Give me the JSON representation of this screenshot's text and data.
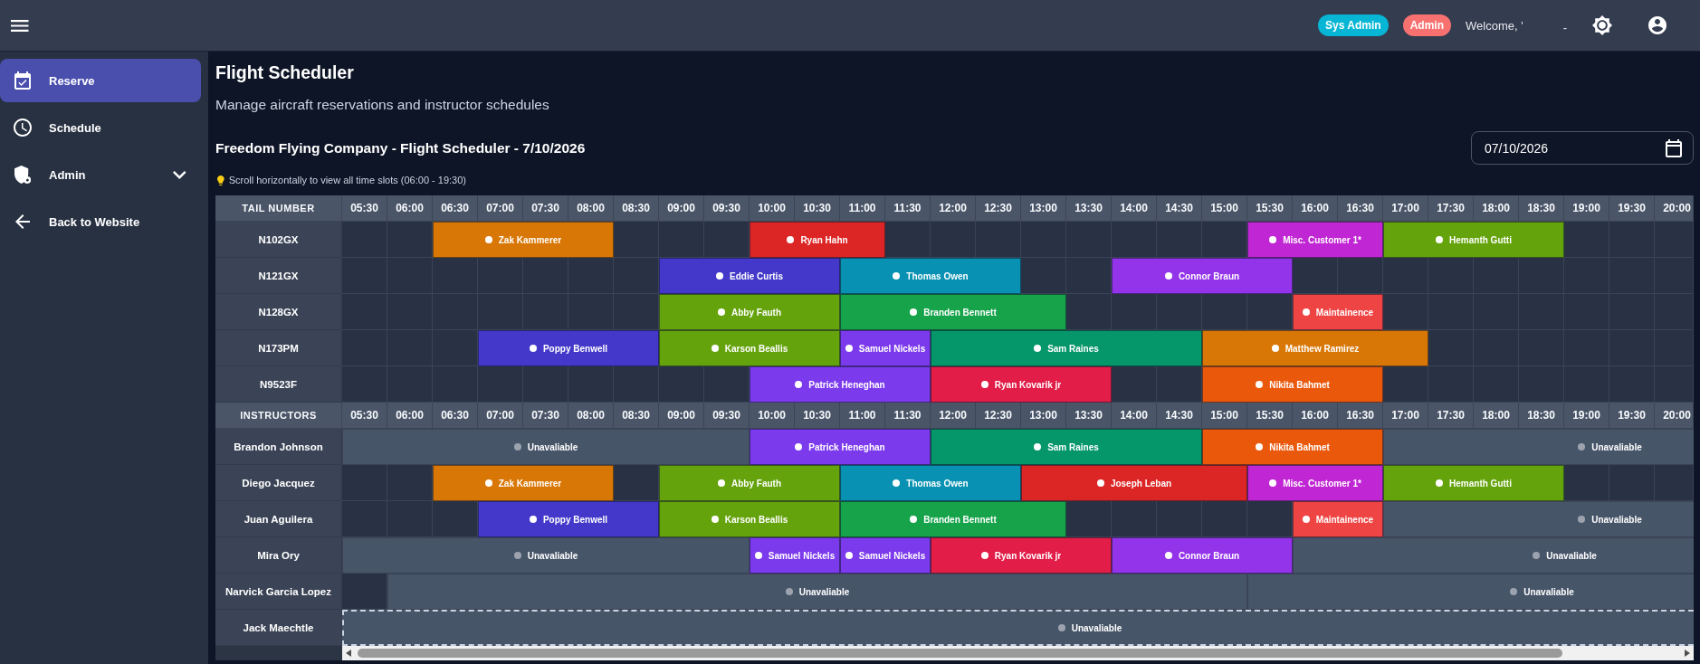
{
  "topbar": {
    "roles": [
      {
        "label": "Sys Admin",
        "color": "#06b6d4"
      },
      {
        "label": "Admin",
        "color": "#f87171"
      }
    ],
    "welcome": "Welcome, '",
    "user": "-"
  },
  "sidebar": {
    "items": [
      {
        "label": "Reserve",
        "kind": "link",
        "selected": true
      },
      {
        "label": "Schedule",
        "kind": "link",
        "selected": false
      },
      {
        "label": "Admin",
        "kind": "group",
        "selected": false,
        "expanded": false
      },
      {
        "label": "Back to Website",
        "kind": "link",
        "selected": false
      }
    ]
  },
  "page": {
    "title": "Flight Scheduler",
    "subtitle": "Manage aircraft reservations and instructor schedules",
    "heading": "Freedom Flying Company - Flight Scheduler - 7/10/2026",
    "date_field": {
      "value": "07/10/2026"
    },
    "hint": "Scroll horizontally to view all time slots (06:00 - 19:30)"
  },
  "scheduler": {
    "sections": [
      {
        "header": "TAIL NUMBER",
        "times": [
          "05:30",
          "06:00",
          "06:30",
          "07:00",
          "07:30",
          "08:00",
          "08:30",
          "09:00",
          "09:30",
          "10:00",
          "10:30",
          "11:00",
          "11:30",
          "12:00",
          "12:30",
          "13:00",
          "13:30",
          "14:00",
          "14:30",
          "15:00",
          "15:30",
          "16:00",
          "16:30",
          "17:00",
          "17:30",
          "18:00",
          "18:30",
          "19:00",
          "19:30",
          "20:00"
        ],
        "rows": [
          {
            "label": "N102GX",
            "slots": [
              {
                "kind": "open"
              },
              {
                "kind": "open"
              },
              {
                "kind": "booking",
                "name": "Zak Kammerer",
                "color": "#d97706"
              },
              {
                "kind": "more"
              },
              {
                "kind": "more"
              },
              {
                "kind": "more"
              },
              {
                "kind": "open"
              },
              {
                "kind": "open"
              },
              {
                "kind": "open"
              },
              {
                "kind": "booking",
                "name": "Ryan Hahn",
                "color": "#dc2626"
              },
              {
                "kind": "more"
              },
              {
                "kind": "more"
              },
              {
                "kind": "open"
              },
              {
                "kind": "open"
              },
              {
                "kind": "open"
              },
              {
                "kind": "open"
              },
              {
                "kind": "open"
              },
              {
                "kind": "open"
              },
              {
                "kind": "open"
              },
              {
                "kind": "open"
              },
              {
                "kind": "booking",
                "name": "Misc. Customer 1*",
                "color": "#c026d3"
              },
              {
                "kind": "more"
              },
              {
                "kind": "more"
              },
              {
                "kind": "booking",
                "name": "Hemanth Gutti",
                "color": "#65a30d"
              },
              {
                "kind": "more"
              },
              {
                "kind": "more"
              },
              {
                "kind": "more"
              },
              {
                "kind": "open"
              },
              {
                "kind": "open"
              },
              {
                "kind": "open"
              }
            ]
          },
          {
            "label": "N121GX",
            "slots": [
              {
                "kind": "open"
              },
              {
                "kind": "open"
              },
              {
                "kind": "open"
              },
              {
                "kind": "open"
              },
              {
                "kind": "open"
              },
              {
                "kind": "open"
              },
              {
                "kind": "open"
              },
              {
                "kind": "booking",
                "name": "Eddie Curtis",
                "color": "#4338ca"
              },
              {
                "kind": "more"
              },
              {
                "kind": "more"
              },
              {
                "kind": "more"
              },
              {
                "kind": "booking",
                "name": "Thomas Owen",
                "color": "#0891b2"
              },
              {
                "kind": "more"
              },
              {
                "kind": "more"
              },
              {
                "kind": "more"
              },
              {
                "kind": "open"
              },
              {
                "kind": "open"
              },
              {
                "kind": "booking",
                "name": "Connor Braun",
                "color": "#9333ea"
              },
              {
                "kind": "more"
              },
              {
                "kind": "more"
              },
              {
                "kind": "more"
              },
              {
                "kind": "open"
              },
              {
                "kind": "open"
              },
              {
                "kind": "open"
              },
              {
                "kind": "open"
              },
              {
                "kind": "open"
              },
              {
                "kind": "open"
              },
              {
                "kind": "open"
              },
              {
                "kind": "open"
              },
              {
                "kind": "open"
              }
            ]
          },
          {
            "label": "N128GX",
            "slots": [
              {
                "kind": "open"
              },
              {
                "kind": "open"
              },
              {
                "kind": "open"
              },
              {
                "kind": "open"
              },
              {
                "kind": "open"
              },
              {
                "kind": "open"
              },
              {
                "kind": "open"
              },
              {
                "kind": "booking",
                "name": "Abby Fauth",
                "color": "#65a30d"
              },
              {
                "kind": "more"
              },
              {
                "kind": "more"
              },
              {
                "kind": "more"
              },
              {
                "kind": "booking",
                "name": "Branden Bennett",
                "color": "#16a34a"
              },
              {
                "kind": "more"
              },
              {
                "kind": "more"
              },
              {
                "kind": "more"
              },
              {
                "kind": "more"
              },
              {
                "kind": "open"
              },
              {
                "kind": "open"
              },
              {
                "kind": "open"
              },
              {
                "kind": "open"
              },
              {
                "kind": "open"
              },
              {
                "kind": "booking",
                "name": "Maintainence",
                "color": "#ef4444"
              },
              {
                "kind": "more"
              },
              {
                "kind": "open"
              },
              {
                "kind": "open"
              },
              {
                "kind": "open"
              },
              {
                "kind": "open"
              },
              {
                "kind": "open"
              },
              {
                "kind": "open"
              },
              {
                "kind": "open"
              }
            ]
          },
          {
            "label": "N173PM",
            "slots": [
              {
                "kind": "open"
              },
              {
                "kind": "open"
              },
              {
                "kind": "open"
              },
              {
                "kind": "booking",
                "name": "Poppy Benwell",
                "color": "#4338ca"
              },
              {
                "kind": "more"
              },
              {
                "kind": "more"
              },
              {
                "kind": "more"
              },
              {
                "kind": "booking",
                "name": "Karson Beallis",
                "color": "#65a30d"
              },
              {
                "kind": "more"
              },
              {
                "kind": "more"
              },
              {
                "kind": "more"
              },
              {
                "kind": "booking",
                "name": "Samuel Nickels",
                "color": "#7c3aed"
              },
              {
                "kind": "more"
              },
              {
                "kind": "booking",
                "name": "Sam Raines",
                "color": "#059669"
              },
              {
                "kind": "more"
              },
              {
                "kind": "more"
              },
              {
                "kind": "more"
              },
              {
                "kind": "more"
              },
              {
                "kind": "more"
              },
              {
                "kind": "booking",
                "name": "Matthew Ramirez",
                "color": "#d97706"
              },
              {
                "kind": "more"
              },
              {
                "kind": "more"
              },
              {
                "kind": "more"
              },
              {
                "kind": "more"
              },
              {
                "kind": "open"
              },
              {
                "kind": "open"
              },
              {
                "kind": "open"
              },
              {
                "kind": "open"
              },
              {
                "kind": "open"
              },
              {
                "kind": "open"
              }
            ]
          },
          {
            "label": "N9523F",
            "slots": [
              {
                "kind": "open"
              },
              {
                "kind": "open"
              },
              {
                "kind": "open"
              },
              {
                "kind": "open"
              },
              {
                "kind": "open"
              },
              {
                "kind": "open"
              },
              {
                "kind": "open"
              },
              {
                "kind": "open"
              },
              {
                "kind": "open"
              },
              {
                "kind": "booking",
                "name": "Patrick Heneghan",
                "color": "#7c3aed"
              },
              {
                "kind": "more"
              },
              {
                "kind": "more"
              },
              {
                "kind": "more"
              },
              {
                "kind": "booking",
                "name": "Ryan Kovarik jr",
                "color": "#e11d48"
              },
              {
                "kind": "more"
              },
              {
                "kind": "more"
              },
              {
                "kind": "more"
              },
              {
                "kind": "open"
              },
              {
                "kind": "open"
              },
              {
                "kind": "booking",
                "name": "Nikita Bahmet",
                "color": "#ea580c"
              },
              {
                "kind": "more"
              },
              {
                "kind": "more"
              },
              {
                "kind": "more"
              },
              {
                "kind": "open"
              },
              {
                "kind": "open"
              },
              {
                "kind": "open"
              },
              {
                "kind": "open"
              },
              {
                "kind": "open"
              },
              {
                "kind": "open"
              },
              {
                "kind": "open"
              }
            ]
          }
        ]
      },
      {
        "header": "INSTRUCTORS",
        "times": [
          "05:30",
          "06:00",
          "06:30",
          "07:00",
          "07:30",
          "08:00",
          "08:30",
          "09:00",
          "09:30",
          "10:00",
          "10:30",
          "11:00",
          "11:30",
          "12:00",
          "12:30",
          "13:00",
          "13:30",
          "14:00",
          "14:30",
          "15:00",
          "15:30",
          "16:00",
          "16:30",
          "17:00",
          "17:30",
          "18:00",
          "18:30",
          "19:00",
          "19:30",
          "20:00"
        ],
        "rows": [
          {
            "label": "Brandon Johnson",
            "highlighted": false,
            "slots": [
              {
                "kind": "unavailable",
                "label": "Unavaliable"
              },
              {
                "kind": "more"
              },
              {
                "kind": "more"
              },
              {
                "kind": "more"
              },
              {
                "kind": "more"
              },
              {
                "kind": "more"
              },
              {
                "kind": "more"
              },
              {
                "kind": "more"
              },
              {
                "kind": "more"
              },
              {
                "kind": "booking",
                "name": "Patrick Heneghan",
                "color": "#7c3aed"
              },
              {
                "kind": "more"
              },
              {
                "kind": "more"
              },
              {
                "kind": "more"
              },
              {
                "kind": "booking",
                "name": "Sam Raines",
                "color": "#059669"
              },
              {
                "kind": "more"
              },
              {
                "kind": "more"
              },
              {
                "kind": "more"
              },
              {
                "kind": "more"
              },
              {
                "kind": "more"
              },
              {
                "kind": "booking",
                "name": "Nikita Bahmet",
                "color": "#ea580c"
              },
              {
                "kind": "more"
              },
              {
                "kind": "more"
              },
              {
                "kind": "more"
              },
              {
                "kind": "unavailable",
                "label": "Unavaliable"
              },
              {
                "kind": "more"
              },
              {
                "kind": "more"
              },
              {
                "kind": "more"
              },
              {
                "kind": "more"
              },
              {
                "kind": "more"
              },
              {
                "kind": "more"
              }
            ]
          },
          {
            "label": "Diego Jacquez",
            "highlighted": false,
            "slots": [
              {
                "kind": "open"
              },
              {
                "kind": "open"
              },
              {
                "kind": "booking",
                "name": "Zak Kammerer",
                "color": "#d97706"
              },
              {
                "kind": "more"
              },
              {
                "kind": "more"
              },
              {
                "kind": "more"
              },
              {
                "kind": "open"
              },
              {
                "kind": "booking",
                "name": "Abby Fauth",
                "color": "#65a30d"
              },
              {
                "kind": "more"
              },
              {
                "kind": "more"
              },
              {
                "kind": "more"
              },
              {
                "kind": "booking",
                "name": "Thomas Owen",
                "color": "#0891b2"
              },
              {
                "kind": "more"
              },
              {
                "kind": "more"
              },
              {
                "kind": "more"
              },
              {
                "kind": "booking",
                "name": "Joseph Leban",
                "color": "#dc2626"
              },
              {
                "kind": "more"
              },
              {
                "kind": "more"
              },
              {
                "kind": "more"
              },
              {
                "kind": "more"
              },
              {
                "kind": "booking",
                "name": "Misc. Customer 1*",
                "color": "#c026d3"
              },
              {
                "kind": "more"
              },
              {
                "kind": "more"
              },
              {
                "kind": "booking",
                "name": "Hemanth Gutti",
                "color": "#65a30d"
              },
              {
                "kind": "more"
              },
              {
                "kind": "more"
              },
              {
                "kind": "more"
              },
              {
                "kind": "open"
              },
              {
                "kind": "open"
              },
              {
                "kind": "open"
              }
            ]
          },
          {
            "label": "Juan Aguilera",
            "highlighted": false,
            "slots": [
              {
                "kind": "open"
              },
              {
                "kind": "open"
              },
              {
                "kind": "open"
              },
              {
                "kind": "booking",
                "name": "Poppy Benwell",
                "color": "#4338ca"
              },
              {
                "kind": "more"
              },
              {
                "kind": "more"
              },
              {
                "kind": "more"
              },
              {
                "kind": "booking",
                "name": "Karson Beallis",
                "color": "#65a30d"
              },
              {
                "kind": "more"
              },
              {
                "kind": "more"
              },
              {
                "kind": "more"
              },
              {
                "kind": "booking",
                "name": "Branden Bennett",
                "color": "#16a34a"
              },
              {
                "kind": "more"
              },
              {
                "kind": "more"
              },
              {
                "kind": "more"
              },
              {
                "kind": "more"
              },
              {
                "kind": "open"
              },
              {
                "kind": "open"
              },
              {
                "kind": "open"
              },
              {
                "kind": "open"
              },
              {
                "kind": "open"
              },
              {
                "kind": "booking",
                "name": "Maintainence",
                "color": "#ef4444"
              },
              {
                "kind": "more"
              },
              {
                "kind": "unavailable",
                "label": "Unavaliable"
              },
              {
                "kind": "more"
              },
              {
                "kind": "more"
              },
              {
                "kind": "more"
              },
              {
                "kind": "more"
              },
              {
                "kind": "more"
              },
              {
                "kind": "more"
              }
            ]
          },
          {
            "label": "Mira Ory",
            "highlighted": false,
            "slots": [
              {
                "kind": "unavailable",
                "label": "Unavaliable"
              },
              {
                "kind": "more"
              },
              {
                "kind": "more"
              },
              {
                "kind": "more"
              },
              {
                "kind": "more"
              },
              {
                "kind": "more"
              },
              {
                "kind": "more"
              },
              {
                "kind": "more"
              },
              {
                "kind": "more"
              },
              {
                "kind": "booking",
                "name": "Samuel Nickels",
                "color": "#7c3aed"
              },
              {
                "kind": "more"
              },
              {
                "kind": "booking",
                "name": "Samuel Nickels",
                "color": "#7c3aed"
              },
              {
                "kind": "more"
              },
              {
                "kind": "booking",
                "name": "Ryan Kovarik jr",
                "color": "#e11d48"
              },
              {
                "kind": "more"
              },
              {
                "kind": "more"
              },
              {
                "kind": "more"
              },
              {
                "kind": "booking",
                "name": "Connor Braun",
                "color": "#9333ea"
              },
              {
                "kind": "more"
              },
              {
                "kind": "more"
              },
              {
                "kind": "more"
              },
              {
                "kind": "unavailable",
                "label": "Unavaliable"
              },
              {
                "kind": "more"
              },
              {
                "kind": "more"
              },
              {
                "kind": "more"
              },
              {
                "kind": "more"
              },
              {
                "kind": "more"
              },
              {
                "kind": "more"
              },
              {
                "kind": "more"
              },
              {
                "kind": "more"
              }
            ]
          },
          {
            "label": "Narvick Garcia Lopez",
            "highlighted": false,
            "slots": [
              {
                "kind": "open"
              },
              {
                "kind": "unavailable",
                "label": "Unavaliable"
              },
              {
                "kind": "more"
              },
              {
                "kind": "more"
              },
              {
                "kind": "more"
              },
              {
                "kind": "more"
              },
              {
                "kind": "more"
              },
              {
                "kind": "more"
              },
              {
                "kind": "more"
              },
              {
                "kind": "more"
              },
              {
                "kind": "more"
              },
              {
                "kind": "more"
              },
              {
                "kind": "more"
              },
              {
                "kind": "more"
              },
              {
                "kind": "more"
              },
              {
                "kind": "more"
              },
              {
                "kind": "more"
              },
              {
                "kind": "more"
              },
              {
                "kind": "more"
              },
              {
                "kind": "more"
              },
              {
                "kind": "unavailable",
                "label": "Unavaliable"
              },
              {
                "kind": "more"
              },
              {
                "kind": "more"
              },
              {
                "kind": "more"
              },
              {
                "kind": "more"
              },
              {
                "kind": "more"
              },
              {
                "kind": "more"
              },
              {
                "kind": "more"
              },
              {
                "kind": "more"
              },
              {
                "kind": "more"
              }
            ]
          },
          {
            "label": "Jack Maechtle",
            "highlighted": true,
            "slots": [
              {
                "kind": "unavailable",
                "label": "Unavaliable"
              },
              {
                "kind": "more"
              },
              {
                "kind": "more"
              },
              {
                "kind": "more"
              },
              {
                "kind": "more"
              },
              {
                "kind": "more"
              },
              {
                "kind": "more"
              },
              {
                "kind": "more"
              },
              {
                "kind": "more"
              },
              {
                "kind": "more"
              },
              {
                "kind": "more"
              },
              {
                "kind": "more"
              },
              {
                "kind": "more"
              },
              {
                "kind": "more"
              },
              {
                "kind": "more"
              },
              {
                "kind": "more"
              },
              {
                "kind": "more"
              },
              {
                "kind": "more"
              },
              {
                "kind": "more"
              },
              {
                "kind": "more"
              },
              {
                "kind": "more"
              },
              {
                "kind": "more"
              },
              {
                "kind": "more"
              },
              {
                "kind": "more"
              },
              {
                "kind": "more"
              },
              {
                "kind": "more"
              },
              {
                "kind": "more"
              },
              {
                "kind": "more"
              },
              {
                "kind": "more"
              },
              {
                "kind": "more"
              }
            ]
          }
        ]
      }
    ]
  }
}
